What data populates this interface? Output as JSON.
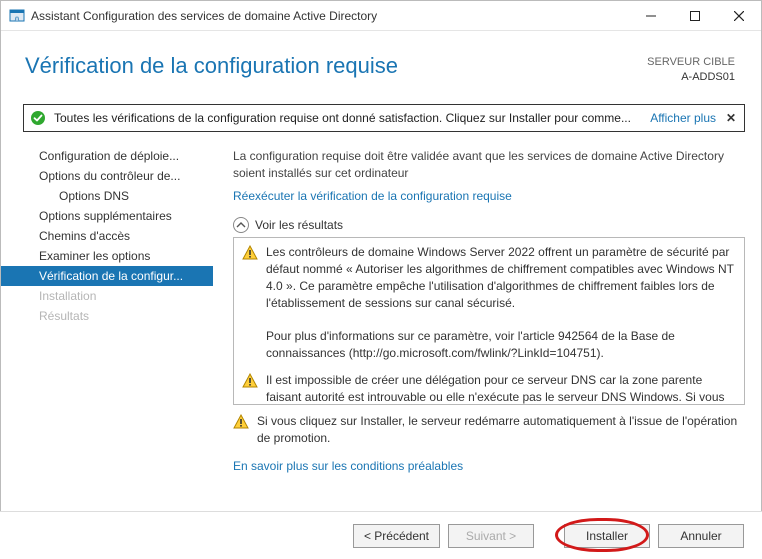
{
  "window": {
    "title": "Assistant Configuration des services de domaine Active Directory"
  },
  "header": {
    "page_title": "Vérification de la configuration requise",
    "target_label": "SERVEUR CIBLE",
    "target_value": "A-ADDS01"
  },
  "status": {
    "message": "Toutes les vérifications de la configuration requise ont donné satisfaction. Cliquez sur Installer pour comme...",
    "show_more": "Afficher plus"
  },
  "nav": {
    "items": [
      {
        "label": "Configuration de déploie...",
        "state": "normal"
      },
      {
        "label": "Options du contrôleur de...",
        "state": "normal"
      },
      {
        "label": "Options DNS",
        "state": "sub"
      },
      {
        "label": "Options supplémentaires",
        "state": "normal"
      },
      {
        "label": "Chemins d'accès",
        "state": "normal"
      },
      {
        "label": "Examiner les options",
        "state": "normal"
      },
      {
        "label": "Vérification de la configur...",
        "state": "active"
      },
      {
        "label": "Installation",
        "state": "disabled"
      },
      {
        "label": "Résultats",
        "state": "disabled"
      }
    ]
  },
  "main": {
    "intro": "La configuration requise doit être validée avant que les services de domaine Active Directory soient installés sur cet ordinateur",
    "rerun_link": "Réexécuter la vérification de la configuration requise",
    "results_head": "Voir les résultats",
    "warnings": [
      "Les contrôleurs de domaine Windows Server 2022 offrent un paramètre de sécurité par défaut nommé « Autoriser les algorithmes de chiffrement compatibles avec Windows NT 4.0 ». Ce paramètre empêche l'utilisation d'algorithmes de chiffrement faibles lors de l'établissement de sessions sur canal sécurisé.\n\nPour plus d'informations sur ce paramètre, voir l'article 942564 de la Base de connaissances (http://go.microsoft.com/fwlink/?LinkId=104751).",
      "Il est impossible de créer une délégation pour ce serveur DNS car la zone parente faisant autorité est introuvable ou elle n'exécute pas le serveur DNS Windows. Si vous procédez à l'intégration avec une infrastructure DNS existante, vous devez"
    ],
    "below_warning": "Si vous cliquez sur Installer, le serveur redémarre automatiquement à l'issue de l'opération de promotion.",
    "learn_more": "En savoir plus sur les conditions préalables"
  },
  "footer": {
    "prev": "< Précédent",
    "next": "Suivant >",
    "install": "Installer",
    "cancel": "Annuler"
  }
}
